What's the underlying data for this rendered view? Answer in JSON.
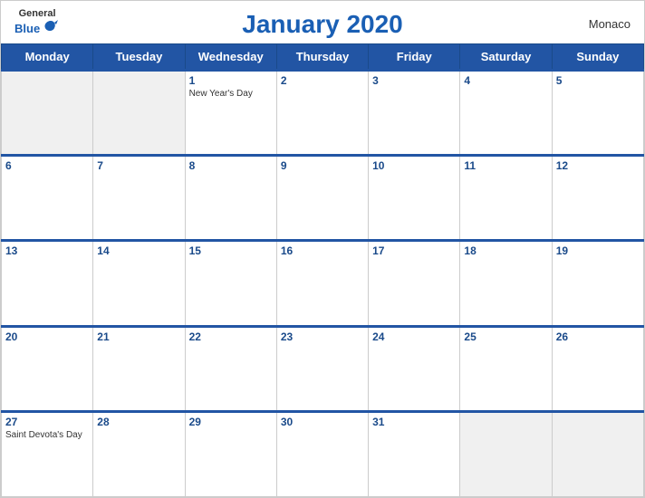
{
  "header": {
    "title": "January 2020",
    "country": "Monaco",
    "logo": {
      "general": "General",
      "blue": "Blue"
    }
  },
  "weekdays": [
    "Monday",
    "Tuesday",
    "Wednesday",
    "Thursday",
    "Friday",
    "Saturday",
    "Sunday"
  ],
  "weeks": [
    [
      {
        "day": "",
        "event": "",
        "empty": true
      },
      {
        "day": "",
        "event": "",
        "empty": true
      },
      {
        "day": "1",
        "event": "New Year's Day",
        "empty": false
      },
      {
        "day": "2",
        "event": "",
        "empty": false
      },
      {
        "day": "3",
        "event": "",
        "empty": false
      },
      {
        "day": "4",
        "event": "",
        "empty": false
      },
      {
        "day": "5",
        "event": "",
        "empty": false
      }
    ],
    [
      {
        "day": "6",
        "event": "",
        "empty": false
      },
      {
        "day": "7",
        "event": "",
        "empty": false
      },
      {
        "day": "8",
        "event": "",
        "empty": false
      },
      {
        "day": "9",
        "event": "",
        "empty": false
      },
      {
        "day": "10",
        "event": "",
        "empty": false
      },
      {
        "day": "11",
        "event": "",
        "empty": false
      },
      {
        "day": "12",
        "event": "",
        "empty": false
      }
    ],
    [
      {
        "day": "13",
        "event": "",
        "empty": false
      },
      {
        "day": "14",
        "event": "",
        "empty": false
      },
      {
        "day": "15",
        "event": "",
        "empty": false
      },
      {
        "day": "16",
        "event": "",
        "empty": false
      },
      {
        "day": "17",
        "event": "",
        "empty": false
      },
      {
        "day": "18",
        "event": "",
        "empty": false
      },
      {
        "day": "19",
        "event": "",
        "empty": false
      }
    ],
    [
      {
        "day": "20",
        "event": "",
        "empty": false
      },
      {
        "day": "21",
        "event": "",
        "empty": false
      },
      {
        "day": "22",
        "event": "",
        "empty": false
      },
      {
        "day": "23",
        "event": "",
        "empty": false
      },
      {
        "day": "24",
        "event": "",
        "empty": false
      },
      {
        "day": "25",
        "event": "",
        "empty": false
      },
      {
        "day": "26",
        "event": "",
        "empty": false
      }
    ],
    [
      {
        "day": "27",
        "event": "Saint Devota's Day",
        "empty": false
      },
      {
        "day": "28",
        "event": "",
        "empty": false
      },
      {
        "day": "29",
        "event": "",
        "empty": false
      },
      {
        "day": "30",
        "event": "",
        "empty": false
      },
      {
        "day": "31",
        "event": "",
        "empty": false
      },
      {
        "day": "",
        "event": "",
        "empty": true
      },
      {
        "day": "",
        "event": "",
        "empty": true
      }
    ]
  ],
  "colors": {
    "header_bg": "#2255a4",
    "header_text": "#ffffff",
    "title_color": "#1a5fb4",
    "day_number_color": "#1a4a8a",
    "empty_bg": "#f5f5f5"
  }
}
